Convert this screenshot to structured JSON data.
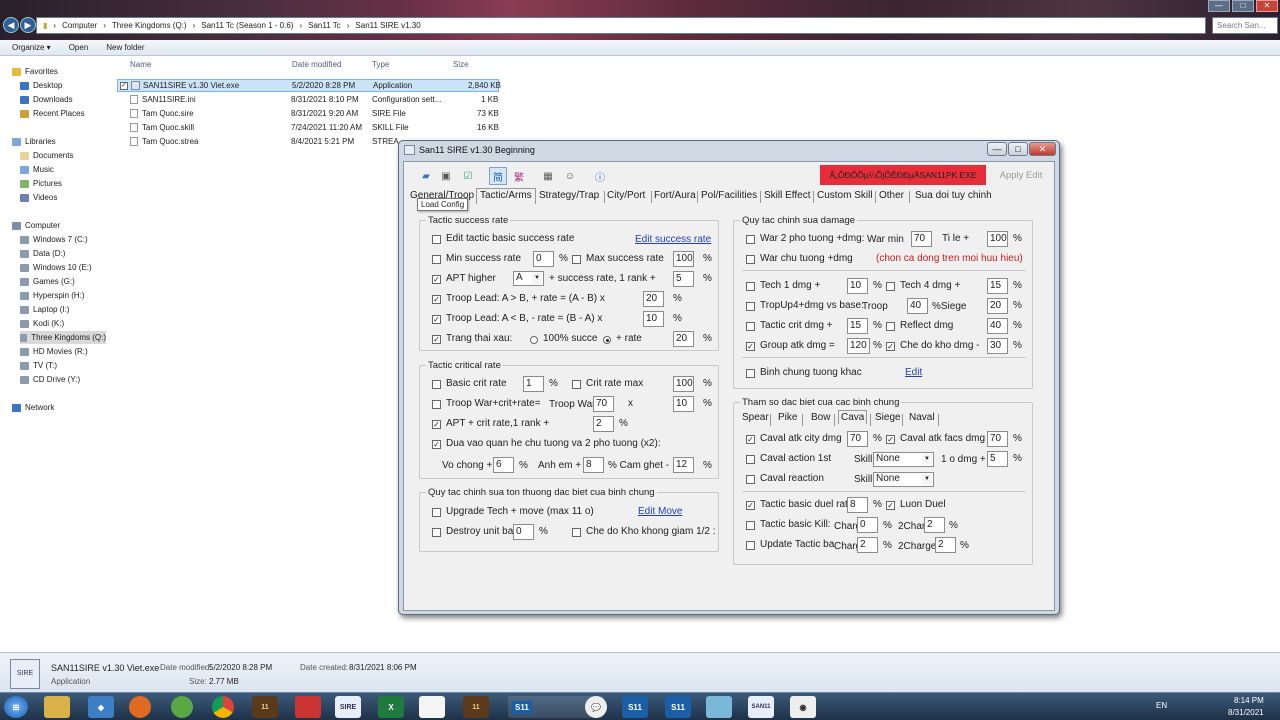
{
  "explorer": {
    "breadcrumb": [
      "Computer",
      "Three Kingdoms (Q:)",
      "San11 Tc (Season 1 - 0.6)",
      "San11 Tc",
      "San11 SIRE v1.30"
    ],
    "search_placeholder": "Search San...",
    "toolbar": {
      "organize": "Organize ▾",
      "open": "Open",
      "new_folder": "New folder"
    },
    "sidebar": {
      "favorites": "Favorites",
      "desktop": "Desktop",
      "downloads": "Downloads",
      "recent": "Recent Places",
      "libraries": "Libraries",
      "documents": "Documents",
      "music": "Music",
      "pictures": "Pictures",
      "videos": "Videos",
      "computer": "Computer",
      "drives": [
        "Windows 7 (C:)",
        "Data (D:)",
        "Windows 10 (E:)",
        "Games (G:)",
        "Hyperspin (H:)",
        "Laptop (I:)",
        "Kodi (K:)",
        "Three Kingdoms (Q:)",
        "HD Movies (R:)",
        "TV (T:)",
        "CD Drive (Y:)"
      ],
      "network": "Network"
    },
    "columns": {
      "name": "Name",
      "date": "Date modified",
      "type": "Type",
      "size": "Size"
    },
    "files": [
      {
        "name": "SAN11SIRE v1.30 Viet.exe",
        "date": "5/2/2020 8:28 PM",
        "type": "Application",
        "size": "2,840 KB"
      },
      {
        "name": "SAN11SIRE.ini",
        "date": "8/31/2021 8:10 PM",
        "type": "Configuration sett...",
        "size": "1 KB"
      },
      {
        "name": "Tam Quoc.sire",
        "date": "8/31/2021 9:20 AM",
        "type": "SIRE File",
        "size": "73 KB"
      },
      {
        "name": "Tam Quoc.skill",
        "date": "7/24/2021 11:20 AM",
        "type": "SKILL File",
        "size": "16 KB"
      },
      {
        "name": "Tam Quoc.strea",
        "date": "8/4/2021 5:21 PM",
        "type": "STREA",
        "size": ""
      }
    ],
    "details": {
      "name": "SAN11SIRE v1.30 Viet.exe",
      "kind": "Application",
      "date_modified_label": "Date modified:",
      "date_modified": "5/2/2020 8:28 PM",
      "size_label": "Size:",
      "size": "2.77 MB",
      "date_created_label": "Date created:",
      "date_created": "8/31/2021 8:06 PM"
    }
  },
  "taskbar": {
    "lang": "EN",
    "time": "8:14 PM",
    "date": "8/31/2021",
    "s11": "S11",
    "san11": "SAN11"
  },
  "app": {
    "title": "San11 SIRE v1.30 Beginning",
    "red_button": "Ã„ÔÐÕÕµ¼ÕjÕÊÐÐµÄSAN11PK.EXE",
    "apply": "Apply Edit",
    "tooltip": "Load Config",
    "tabs": [
      "General/Troop",
      "Tactic/Arms",
      "Strategy/Trap",
      "City/Port",
      "Fort/Aura",
      "Pol/Facilities",
      "Skill Effect",
      "Custom Skill",
      "Other",
      "Sua doi tuy chinh"
    ],
    "success": {
      "title": "Tactic success rate",
      "edit_basic": "Edit tactic basic success rate",
      "edit_link": "Edit success rate",
      "min_label": "Min success rate",
      "min_val": "0",
      "pct": "%",
      "max_label": "Max success rate",
      "max_val": "100",
      "apt_label": "APT higher",
      "apt_sel": "A",
      "apt_suffix": "+ success rate, 1 rank +",
      "apt_val": "5",
      "lead_a": "Troop Lead: A > B, + rate = (A - B) x",
      "lead_a_val": "20",
      "lead_b": "Troop Lead: A < B, - rate = (B - A) x",
      "lead_b_val": "10",
      "trang": "Trang thai xau:",
      "r100": "100% succe",
      "rrate": "+ rate",
      "trang_val": "20"
    },
    "critical": {
      "title": "Tactic critical rate",
      "basic": "Basic crit rate",
      "basic_val": "1",
      "max": "Crit rate max",
      "max_val": "100",
      "war": "Troop War+crit+rate=",
      "war2": "Troop War",
      "war_val": "70",
      "x": "x",
      "war_val2": "10",
      "apt": "APT + crit rate,1 rank +",
      "apt_val": "2",
      "dua": "Dua vao quan he chu tuong va 2 pho tuong (x2):",
      "vo": "Vo chong +",
      "vo_val": "6",
      "anh": "Anh em +",
      "anh_val": "8",
      "cam": "% Cam ghet -",
      "cam_val": "12"
    },
    "special": {
      "title": "Quy tac chinh sua ton thuong dac biet cua binh chung",
      "upgrade": "Upgrade Tech + move (max 11 o)",
      "edit_move": "Edit Move",
      "destroy": "Destroy unit bas",
      "destroy_val": "0",
      "che": "Che do Kho khong giam 1/2 :"
    },
    "damage": {
      "title": "Quy tac chinh sua damage",
      "war2": "War 2 pho tuong +dmg:",
      "war_min": "War min",
      "war_min_val": "70",
      "tile": "Ti le +",
      "tile_val": "100",
      "warchu": "War chu tuong +dmg",
      "chon": "(chon ca dong tren moi huu hieu)",
      "tech1": "Tech 1 dmg +",
      "tech1_val": "10",
      "tech4": "Tech 4 dmg +",
      "tech4_val": "15",
      "tropup": "TropUp4+dmg vs base:",
      "troop": "Troop",
      "troop_val": "40",
      "siege": "%Siege",
      "siege_val": "20",
      "crit": "Tactic crit dmg +",
      "crit_val": "15",
      "reflect": "Reflect dmg",
      "reflect_val": "40",
      "group": "Group atk dmg =",
      "group_val": "120",
      "che": "Che do kho dmg -",
      "che_val": "30",
      "binh": "Binh chung tuong khac",
      "edit": "Edit"
    },
    "arms": {
      "title": "Tham so dac biet cua cac binh chung",
      "tabs": [
        "Spear",
        "Pike",
        "Bow",
        "Cava",
        "Siege",
        "Naval"
      ],
      "city": "Caval atk city dmg",
      "city_val": "70",
      "facs": "Caval atk facs dmg",
      "facs_val": "70",
      "action": "Caval action 1st",
      "skill": "Skill",
      "skill_sel": "None",
      "odmg": "1 o dmg +",
      "odmg_val": "5",
      "reaction": "Caval reaction",
      "skill_sel2": "None",
      "duel": "Tactic basic duel rat",
      "duel_val": "8",
      "luon": "Luon Duel",
      "kill": "Tactic basic Kill:",
      "charg": "Charg",
      "kill_val": "0",
      "char2": "2Char",
      "kill_val2": "2",
      "update": "Update Tactic ba",
      "upd_val": "2",
      "charge2": "2Charge",
      "upd_val2": "2"
    }
  }
}
